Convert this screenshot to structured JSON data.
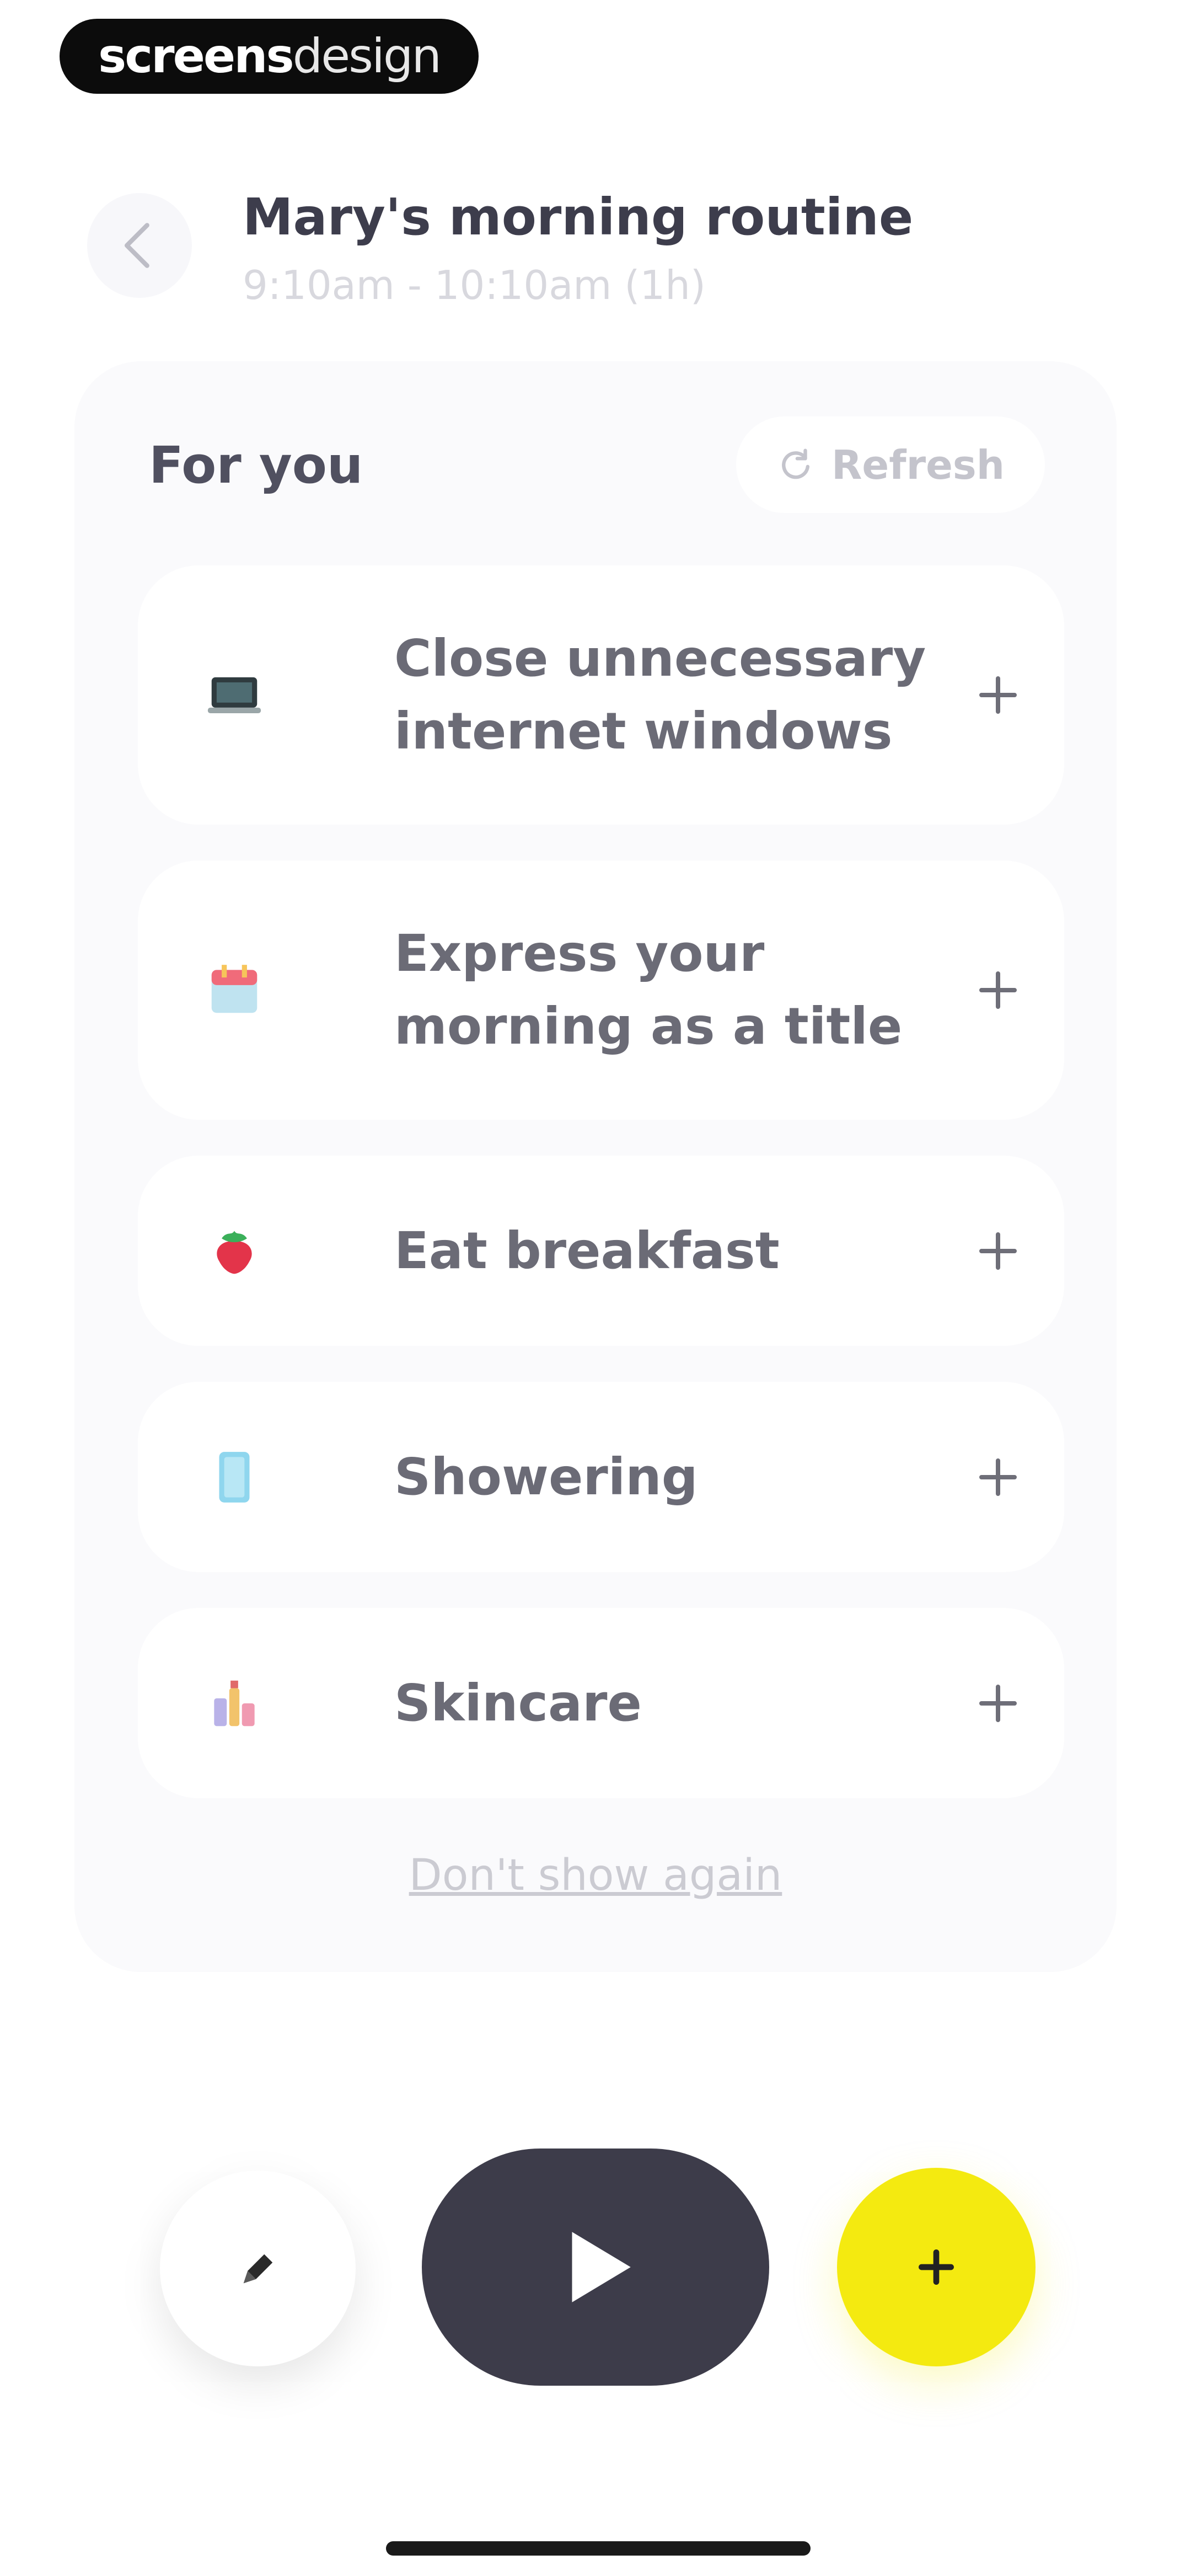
{
  "watermark": {
    "bold_part": "screens",
    "thin_part": "design"
  },
  "header": {
    "title": "Mary's morning routine",
    "subtitle": "9:10am - 10:10am  (1h)"
  },
  "panel": {
    "heading": "For you",
    "refresh_label": "Refresh",
    "suggestions": [
      {
        "icon": "laptop-icon",
        "label": "Close unnecessary internet windows",
        "action": "add"
      },
      {
        "icon": "calendar-icon",
        "label": "Express your morning as a title",
        "action": "add"
      },
      {
        "icon": "strawberry-icon",
        "label": "Eat breakfast",
        "action": "add"
      },
      {
        "icon": "shower-icon",
        "label": "Showering",
        "action": "add"
      },
      {
        "icon": "skincare-icon",
        "label": "Skincare",
        "action": "add"
      }
    ],
    "dismiss_label": "Don't show again"
  },
  "controls": {
    "edit_icon": "pencil-icon",
    "play_icon": "play-icon",
    "add_icon": "plus-icon",
    "add_color": "#f4ea10",
    "play_color": "#3d3c4a"
  }
}
